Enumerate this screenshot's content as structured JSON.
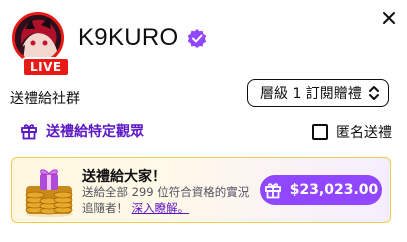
{
  "channel": {
    "name": "K9KURO",
    "live_label": "LIVE"
  },
  "gift": {
    "community_label": "送禮給社群",
    "tier_selected": "層級 1 訂閱贈禮",
    "specific_viewer_label": "送禮給特定觀眾",
    "anonymous_label": "匿名送禮"
  },
  "promo": {
    "title": "送禮給大家！",
    "description": "送給全部 299 位符合資格的實況追隨者！",
    "learn_more": "深入瞭解。",
    "price": "$23,023.00"
  },
  "icons": {
    "close": "close-icon",
    "verified": "verified-badge-icon",
    "gift": "gift-icon",
    "select_arrows": "up-down-chevron-icon",
    "coins": "gift-coins-stack-illustration"
  },
  "colors": {
    "brand_purple": "#9147ff",
    "link_purple": "#5c16c5",
    "live_red": "#e91916",
    "promo_border": "#f2c94c"
  }
}
